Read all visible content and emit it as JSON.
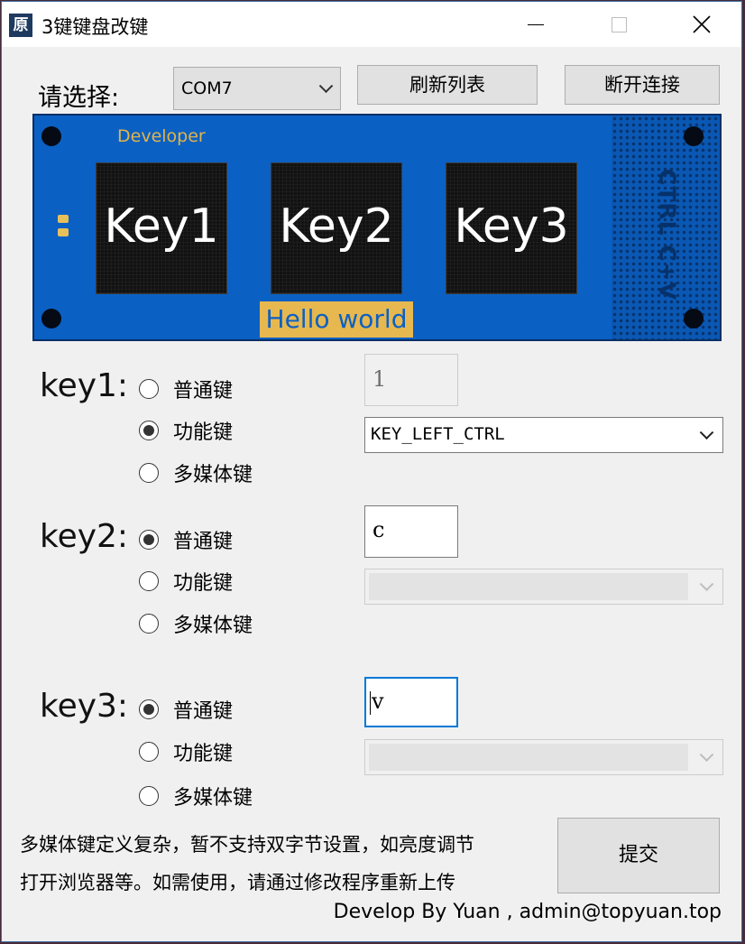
{
  "window": {
    "icon_char": "原",
    "title": "3键键盘改键"
  },
  "top": {
    "select_label": "请选择:",
    "port_value": "COM7",
    "refresh_label": "刷新列表",
    "disconnect_label": "断开连接"
  },
  "board": {
    "developer": "Developer",
    "keys": [
      "Key1",
      "Key2",
      "Key3"
    ],
    "banner": "Hello world",
    "side_text": "CTRL C+V"
  },
  "radio_labels": {
    "normal": "普通键",
    "function": "功能键",
    "media": "多媒体键"
  },
  "key1": {
    "label": "key1:",
    "selected": "function",
    "text_value": "1",
    "function_value": "KEY_LEFT_CTRL"
  },
  "key2": {
    "label": "key2:",
    "selected": "normal",
    "text_value": "c",
    "function_value": ""
  },
  "key3": {
    "label": "key3:",
    "selected": "normal",
    "text_value": "v",
    "function_value": ""
  },
  "notice": {
    "line1": "多媒体键定义复杂，暂不支持双字节设置，如亮度调节",
    "line2": "打开浏览器等。如需使用，请通过修改程序重新上传"
  },
  "submit_label": "提交",
  "footer": "Develop By Yuan , admin@topyuan.top",
  "colors": {
    "board_blue": "#0b60c4",
    "banner_yellow": "#e7b84f",
    "focus_blue": "#0078d7"
  }
}
